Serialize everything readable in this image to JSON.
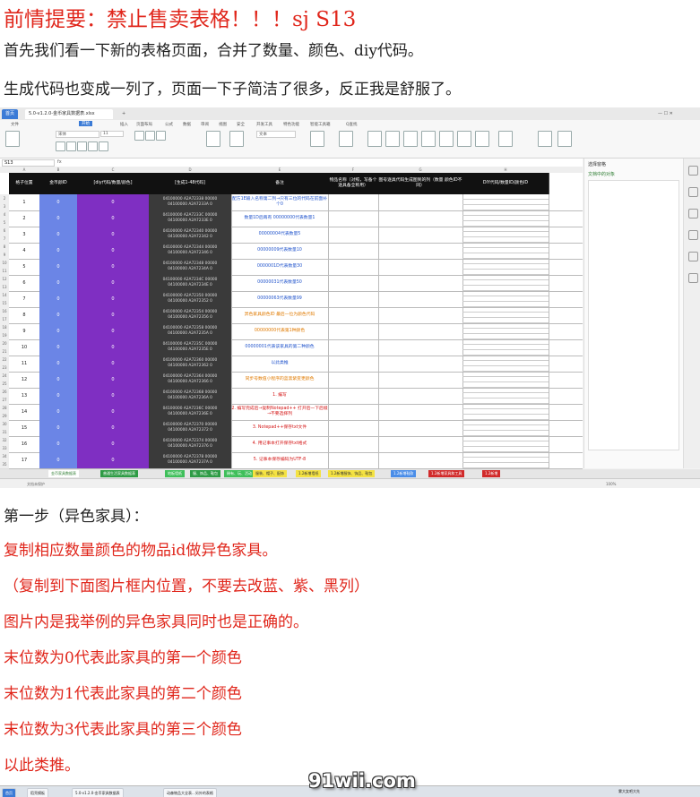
{
  "headline": "前情提要：禁止售卖表格！！！sj S13",
  "intro_lines": [
    "首先我们看一下新的表格页面，合并了数量、颜色、diy代码。",
    "生成代码也变成一列了，页面一下子简洁了很多，反正我是舒服了。"
  ],
  "app": {
    "home_tab": "首页",
    "file_tab": "5.0-v1.2.0-金币家具数据表.xlsx",
    "menu": [
      "文件",
      "开始",
      "插入",
      "页面布局",
      "公式",
      "数据",
      "审阅",
      "视图",
      "安全",
      "开发工具",
      "特色功能",
      "智能工具箱",
      "Q查找"
    ],
    "active_menu": "开始",
    "font_name": "宋体",
    "font_size": "11",
    "format_box": "文本",
    "name_box": "S13",
    "right_panel_title": "选择窗格",
    "right_panel_item": "文档中的对象"
  },
  "sheet": {
    "headers": [
      "格子位置",
      "金币颜ID",
      "[diy代码/数量/颜色]",
      "[生成1-48代码]",
      "备注",
      "物品名称（对照，写备个逐具备全称用）",
      "图号逐具代码生成图到的列（数量 颜色ID不同）",
      "DIY代码/数量ID/颜色ID"
    ],
    "col_letters": [
      "A",
      "B",
      "C",
      "D",
      "E",
      "F",
      "G",
      "H"
    ],
    "rows": [
      {
        "pos": "1",
        "color_id": "0",
        "diy": "0",
        "gen": [
          "04100000 A2A72338 00000",
          "04100000 A2A7233A 0"
        ],
        "note": "配方1E输入名称第二列→只有三位的代码在前面补个0",
        "note_color": "blue"
      },
      {
        "pos": "2",
        "color_id": "0",
        "diy": "0",
        "gen": [
          "04100000 A2A7233C 00000",
          "04100000 A2A7233E 0"
        ],
        "note": "数量1D后再有 00000000代表数量1",
        "note_color": "blue"
      },
      {
        "pos": "3",
        "color_id": "0",
        "diy": "0",
        "gen": [
          "04100000 A2A72340 00000",
          "04100000 A2A72342 0"
        ],
        "note": "00000004代表数量5",
        "note_color": "blue"
      },
      {
        "pos": "4",
        "color_id": "0",
        "diy": "0",
        "gen": [
          "04100000 A2A72344 00000",
          "04100000 A2A72346 0"
        ],
        "note": "00000009代表数量10",
        "note_color": "blue"
      },
      {
        "pos": "5",
        "color_id": "0",
        "diy": "0",
        "gen": [
          "04100000 A2A72348 00000",
          "04100000 A2A7234A 0"
        ],
        "note": "0000001D代表数量30",
        "note_color": "blue"
      },
      {
        "pos": "6",
        "color_id": "0",
        "diy": "0",
        "gen": [
          "04100000 A2A7234C 00000",
          "04100000 A2A7234E 0"
        ],
        "note": "00000031代表数量50",
        "note_color": "blue"
      },
      {
        "pos": "7",
        "color_id": "0",
        "diy": "0",
        "gen": [
          "04100000 A2A72350 00000",
          "04100000 A2A72352 0"
        ],
        "note": "00000063代表数量99",
        "note_color": "blue"
      },
      {
        "pos": "8",
        "color_id": "0",
        "diy": "0",
        "gen": [
          "04100000 A2A72354 00000",
          "04100000 A2A72356 0"
        ],
        "note": "异色家具颜色ID 最后一位为颜色代码",
        "note_color": "orange"
      },
      {
        "pos": "9",
        "color_id": "0",
        "diy": "0",
        "gen": [
          "04100000 A2A72358 00000",
          "04100000 A2A7235A 0"
        ],
        "note": "00000000代表第1种颜色",
        "note_color": "orange"
      },
      {
        "pos": "10",
        "color_id": "0",
        "diy": "0",
        "gen": [
          "04100000 A2A7235C 00000",
          "04100000 A2A7235E 0"
        ],
        "note": "00000001代表该家具的第二种颜色",
        "note_color": "blue"
      },
      {
        "pos": "11",
        "color_id": "0",
        "diy": "0",
        "gen": [
          "04100000 A2A72360 00000",
          "04100000 A2A72362 0"
        ],
        "note": "以此类推",
        "note_color": "blue"
      },
      {
        "pos": "12",
        "color_id": "0",
        "diy": "0",
        "gen": [
          "04100000 A2A72364 00000",
          "04100000 A2A72366 0"
        ],
        "note": "同步号数值小程序的蓝黑紫变更颜色",
        "note_color": "orange"
      },
      {
        "pos": "13",
        "color_id": "0",
        "diy": "0",
        "gen": [
          "04100000 A2A72368 00000",
          "04100000 A2A7236A 0"
        ],
        "note": "1. 编写",
        "note_color": "red"
      },
      {
        "pos": "14",
        "color_id": "0",
        "diy": "0",
        "gen": [
          "04100000 A2A7236C 00000",
          "04100000 A2A7236E 0"
        ],
        "note": "2. 编写完成后→复制Notepad++ 打开后一下后缀→不要选择列",
        "note_color": "red"
      },
      {
        "pos": "15",
        "color_id": "0",
        "diy": "0",
        "gen": [
          "04100000 A2A72370 00000",
          "04100000 A2A72372 0"
        ],
        "note": "3. Notepad++保存txt文件",
        "note_color": "red"
      },
      {
        "pos": "16",
        "color_id": "0",
        "diy": "0",
        "gen": [
          "04100000 A2A72374 00000",
          "04100000 A2A72376 0"
        ],
        "note": "4. 用记事本打开保存txt格式",
        "note_color": "red"
      },
      {
        "pos": "17",
        "color_id": "0",
        "diy": "0",
        "gen": [
          "04100000 A2A72378 00000",
          "04100000 A2A7237A 0"
        ],
        "note": "5. 记事本保存编码为UTF-8",
        "note_color": "red"
      }
    ],
    "sheet_tabs": [
      "金币家具数据表",
      "普通生活家具数据表",
      "地板墙纸",
      "服、饰品、鞋包",
      "稀有、玩、活动",
      "服装、帽子、配饰",
      "1.2新增墙纸",
      "1.2新增服饰、饰品、鞋包",
      "1.2新增鞋款",
      "1.2新增家具和工具",
      "1.2新增"
    ],
    "status_left": "文档未保护",
    "zoom": "100%"
  },
  "step_title": "第一步（异色家具）：",
  "step_lines": [
    "复制相应数量颜色的物品id做异色家具。",
    "（复制到下面图片框内位置，不要去改蓝、紫、黑列）",
    "图片内是我举例的异色家具同时也是正确的。",
    "末位数为0代表此家具的第一个颜色",
    "末位数为1代表此家具的第二个颜色",
    "末位数为3代表此家具的第三个颜色",
    "以此类推。"
  ],
  "taskbar": {
    "tabs": [
      "首页",
      "稻壳模板",
      "5.0-v1.2.0-金币家具数据表",
      "动森物品大全表...另外的表格"
    ],
    "user": "雾大女吧大先"
  },
  "watermark": "91wii.com"
}
